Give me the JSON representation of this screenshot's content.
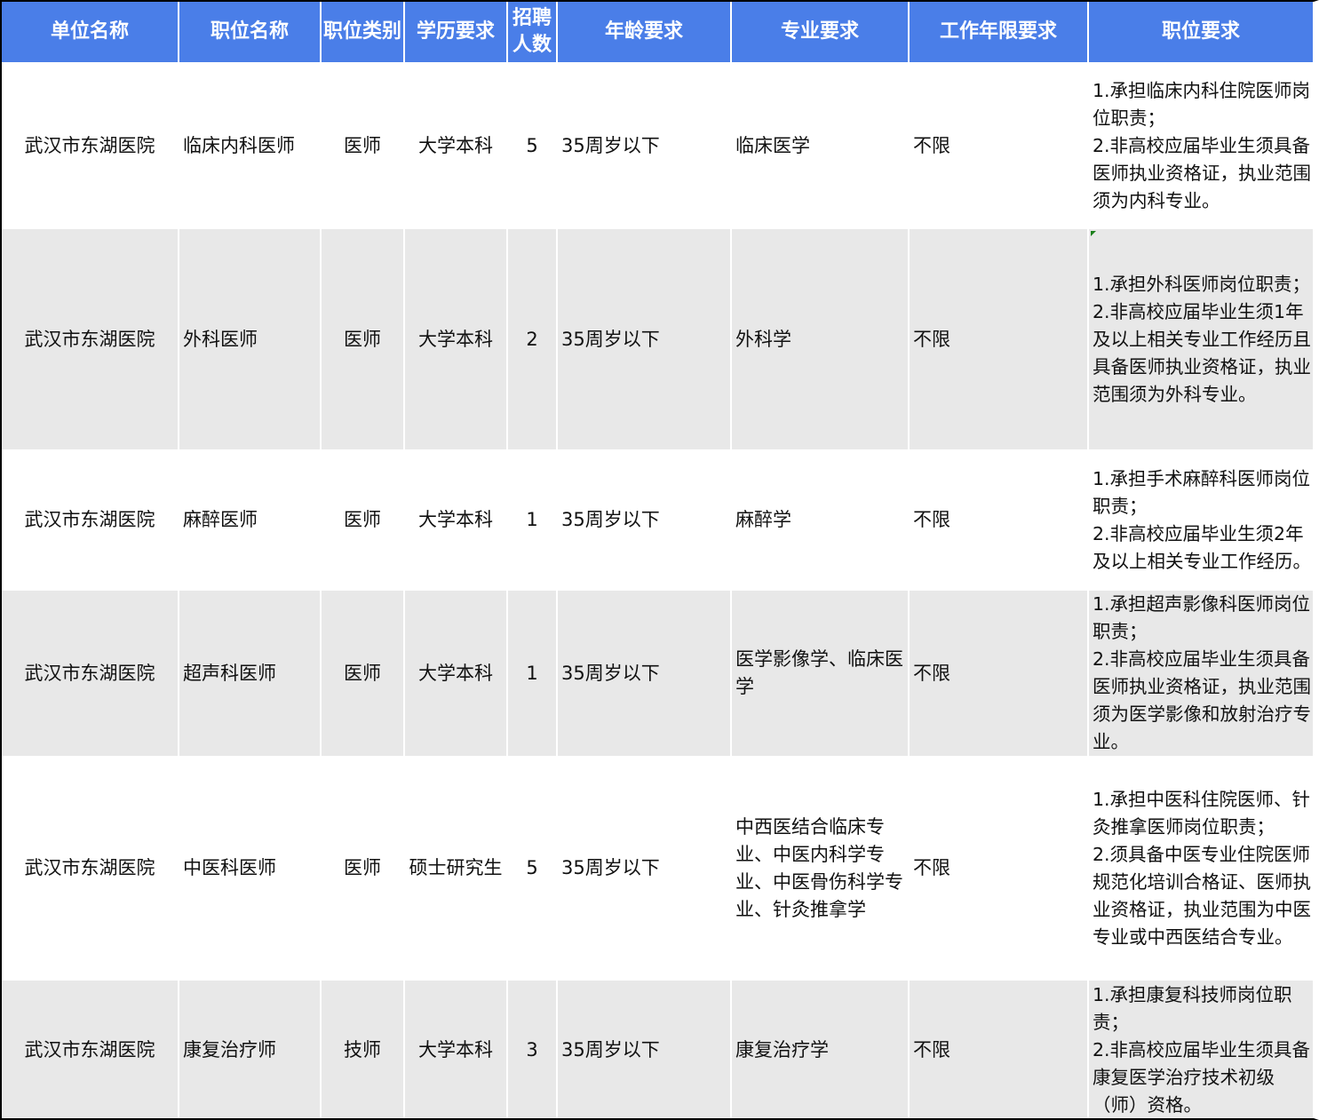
{
  "headers": {
    "unit": "单位名称",
    "position": "职位名称",
    "category": "职位类别",
    "education": "学历要求",
    "count": "招聘人数",
    "age": "年龄要求",
    "major": "专业要求",
    "experience": "工作年限要求",
    "requirements": "职位要求"
  },
  "rows": [
    {
      "unit": "武汉市东湖医院",
      "position": "临床内科医师",
      "category": "医师",
      "education": "大学本科",
      "count": "5",
      "age": "35周岁以下",
      "major": "临床医学",
      "experience": "不限",
      "requirements": "1.承担临床内科住院医师岗位职责；\n2.非高校应届毕业生须具备医师执业资格证，执业范围须为内科专业。"
    },
    {
      "unit": "武汉市东湖医院",
      "position": "外科医师",
      "category": "医师",
      "education": "大学本科",
      "count": "2",
      "age": "35周岁以下",
      "major": "外科学",
      "experience": "不限",
      "requirements": "1.承担外科医师岗位职责；\n2.非高校应届毕业生须1年及以上相关专业工作经历且具备医师执业资格证，执业范围须为外科专业。"
    },
    {
      "unit": "武汉市东湖医院",
      "position": "麻醉医师",
      "category": "医师",
      "education": "大学本科",
      "count": "1",
      "age": "35周岁以下",
      "major": "麻醉学",
      "experience": "不限",
      "requirements": "1.承担手术麻醉科医师岗位职责；\n2.非高校应届毕业生须2年及以上相关专业工作经历。"
    },
    {
      "unit": "武汉市东湖医院",
      "position": "超声科医师",
      "category": "医师",
      "education": "大学本科",
      "count": "1",
      "age": "35周岁以下",
      "major": "医学影像学、临床医学",
      "experience": "不限",
      "requirements": "1.承担超声影像科医师岗位职责；\n2.非高校应届毕业生须具备医师执业资格证，执业范围须为医学影像和放射治疗专业。"
    },
    {
      "unit": "武汉市东湖医院",
      "position": "中医科医师",
      "category": "医师",
      "education": "硕士研究生",
      "count": "5",
      "age": "35周岁以下",
      "major": "中西医结合临床专业、中医内科学专业、中医骨伤科学专业、针灸推拿学",
      "experience": "不限",
      "requirements": "1.承担中医科住院医师、针灸推拿医师岗位职责；\n2.须具备中医专业住院医师规范化培训合格证、医师执业资格证，执业范围为中医专业或中西医结合专业。"
    },
    {
      "unit": "武汉市东湖医院",
      "position": "康复治疗师",
      "category": "技师",
      "education": "大学本科",
      "count": "3",
      "age": "35周岁以下",
      "major": "康复治疗学",
      "experience": "不限",
      "requirements": "1.承担康复科技师岗位职责；\n2.非高校应届毕业生须具备康复医学治疗技术初级（师）资格。"
    }
  ],
  "colors": {
    "header_bg": "#4a7ee8",
    "header_text": "#ffffff",
    "row_alt_bg": "#e8e8e8"
  }
}
